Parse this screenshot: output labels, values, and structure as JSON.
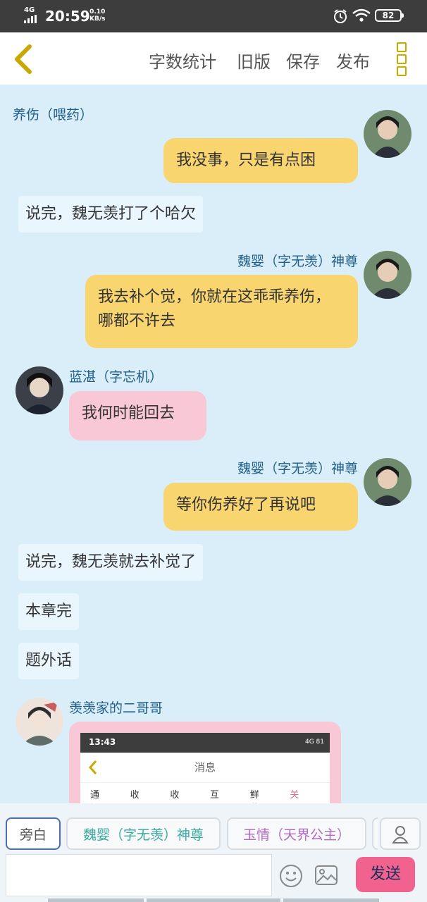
{
  "status": {
    "network": "4G",
    "time": "20:59",
    "speed_value": "0.10",
    "speed_unit": "KB/s",
    "battery": "82"
  },
  "toolbar": {
    "word_count": "字数统计",
    "old_version": "旧版",
    "save": "保存",
    "publish": "发布"
  },
  "chat": {
    "top_name": "养伤（喂药）",
    "messages": [
      {
        "speaker": "",
        "text": "我没事，只是有点困"
      },
      {
        "narration": "说完，魏无羡打了个哈欠"
      },
      {
        "speaker": "魏婴（字无羡）神尊",
        "text": "我去补个觉，你就在这乖乖养伤，哪都不许去"
      },
      {
        "speaker": "蓝湛（字忘机）",
        "text": "我何时能回去"
      },
      {
        "speaker": "魏婴（字无羡）神尊",
        "text": "等你伤养好了再说吧"
      },
      {
        "narration": "说完，魏无羡就去补觉了"
      },
      {
        "narration": "本章完"
      },
      {
        "narration": "题外话"
      },
      {
        "speaker": "羡羡家的二哥哥",
        "image": {
          "time": "13:43",
          "net": "4G",
          "battery": "81",
          "title": "消息",
          "tabs": [
            "通知",
            "收益",
            "收藏",
            "互动",
            "鲜花",
            "关注"
          ]
        }
      }
    ]
  },
  "roles": [
    "旁白",
    "魏婴（字无羡）神尊",
    "玉情（天界公主）"
  ],
  "composer": {
    "send": "发送",
    "placeholder": ""
  },
  "colors": {
    "background": "#d9eef9",
    "me_bubble": "#f8d56f",
    "other_bubble": "#f9c8d6",
    "send_button": "#f2628f",
    "name_text": "#1f5e88"
  }
}
